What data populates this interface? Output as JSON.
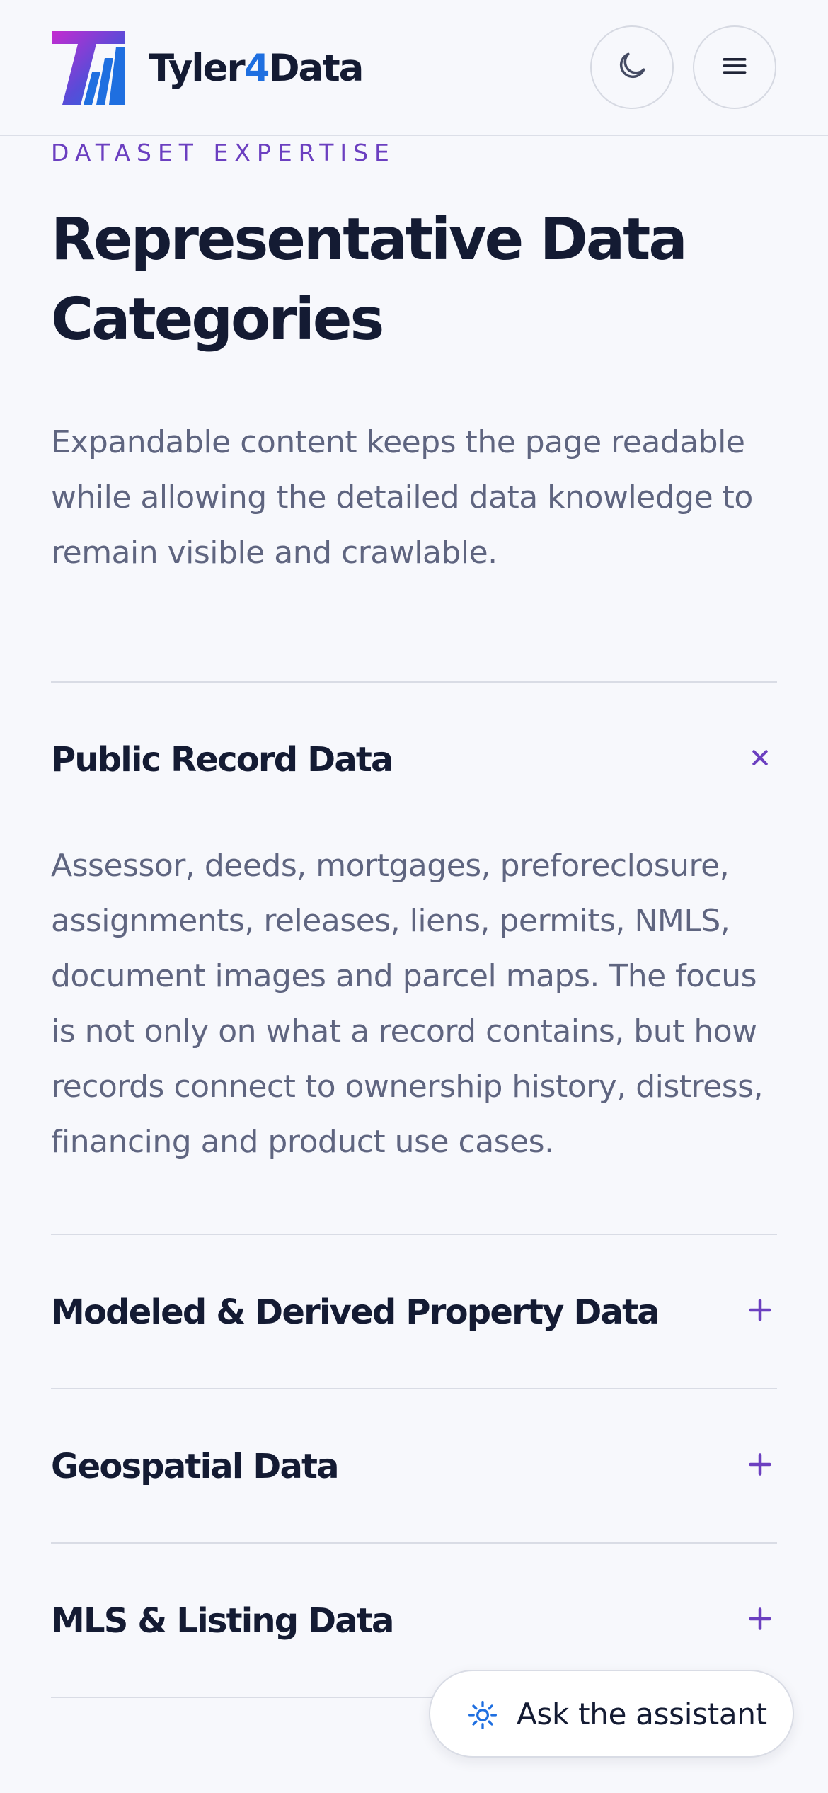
{
  "header": {
    "brand_prefix": "Tyler",
    "brand_four": "4",
    "brand_suffix": "Data",
    "theme_toggle_icon": "moon-icon",
    "menu_icon": "hamburger-menu-icon"
  },
  "section": {
    "eyebrow": "DATASET EXPERTISE",
    "title": "Representative Data Categories",
    "lead": "Expandable content keeps the page readable while allowing the detailed data knowledge to remain visible and crawlable."
  },
  "accordion": {
    "items": [
      {
        "title": "Public Record Data",
        "expanded": true,
        "icon": "close-icon",
        "body": "Assessor, deeds, mortgages, preforeclosure, assignments, releases, liens, permits, NMLS, document images and parcel maps. The focus is not only on what a record contains, but how records connect to ownership history, distress, financing and product use cases."
      },
      {
        "title": "Modeled & Derived Property Data",
        "expanded": false,
        "icon": "plus-icon"
      },
      {
        "title": "Geospatial Data",
        "expanded": false,
        "icon": "plus-icon"
      },
      {
        "title": "MLS & Listing Data",
        "expanded": false,
        "icon": "plus-icon"
      }
    ]
  },
  "assistant": {
    "label": "Ask the assistant",
    "icon": "sun-sparkle-icon"
  },
  "colors": {
    "accent_purple": "#6b3fc0",
    "brand_blue": "#1f6fe0",
    "text_dark": "#141b33",
    "text_muted": "#5f6580",
    "background": "#f7f8fc"
  }
}
